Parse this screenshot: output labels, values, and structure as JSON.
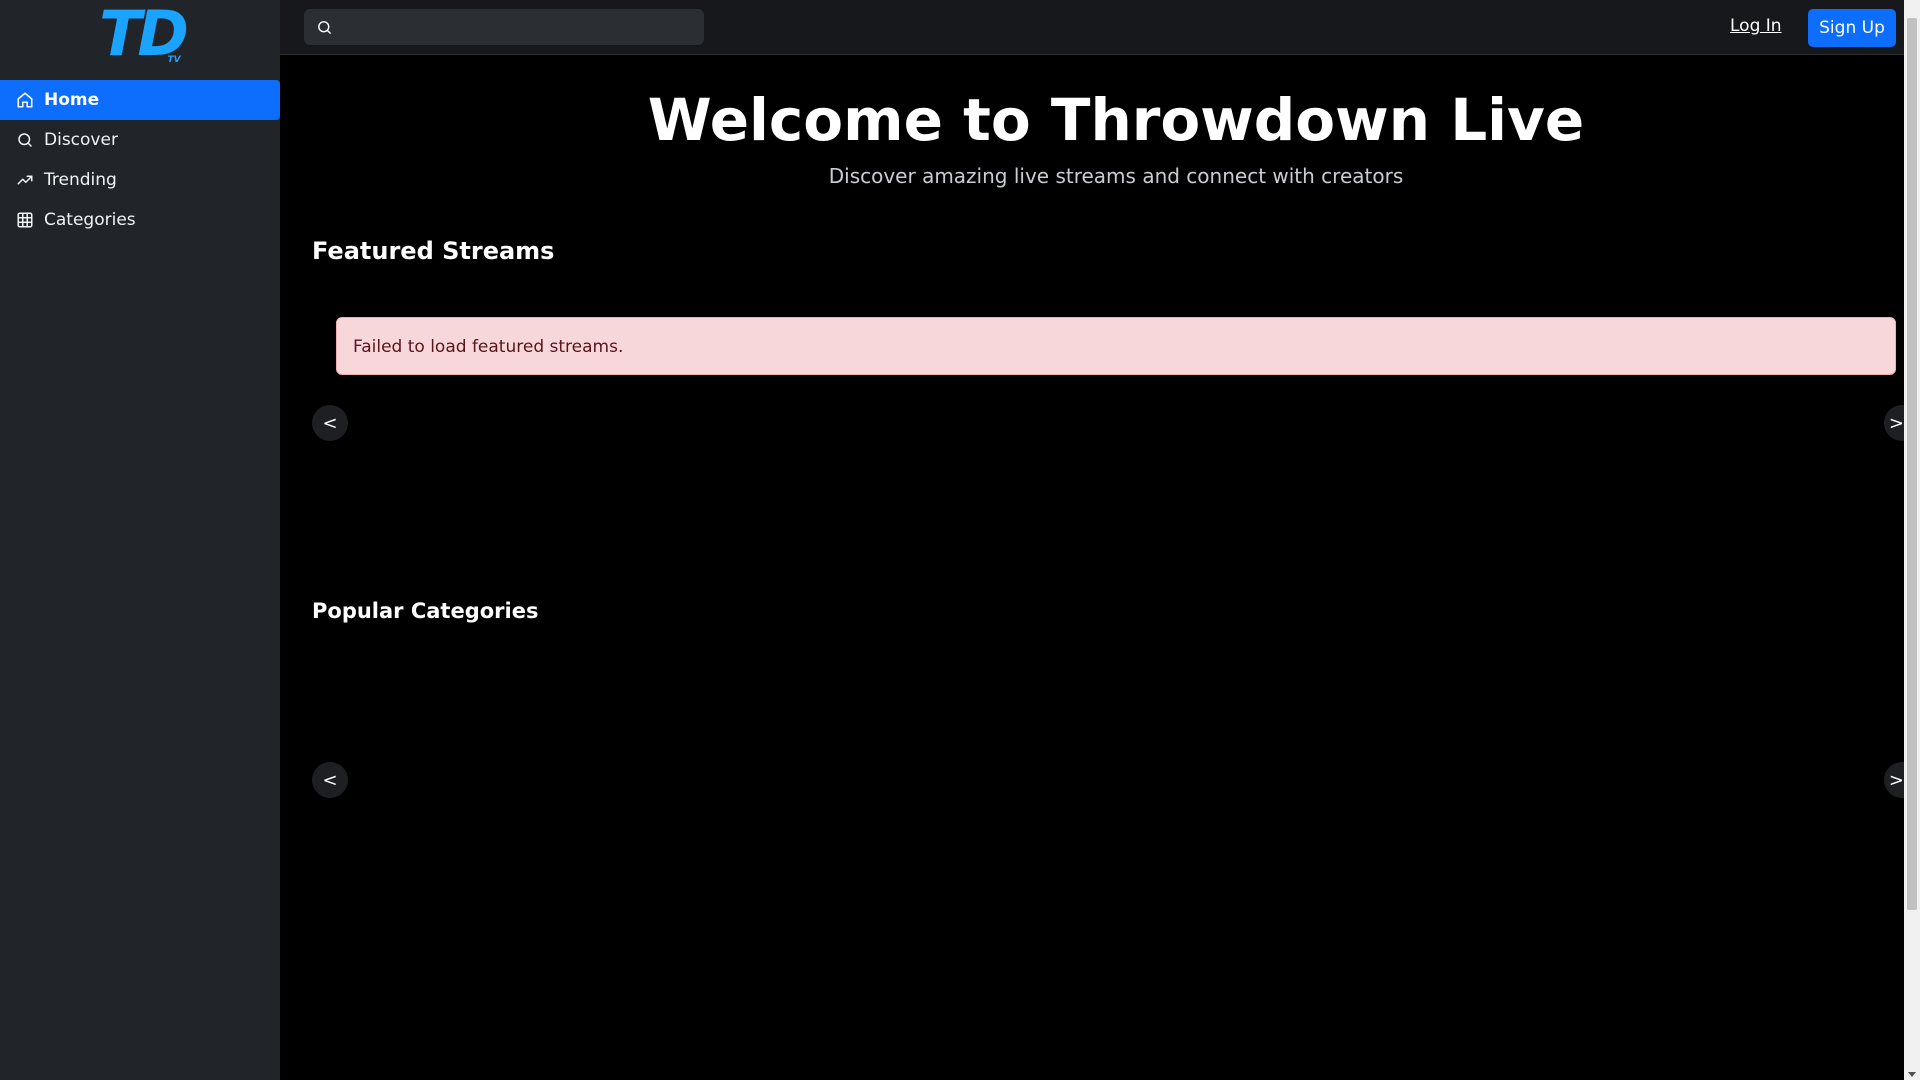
{
  "brand": {
    "logo_main": "TD",
    "logo_sub": "TV"
  },
  "sidebar": {
    "items": [
      {
        "label": "Home",
        "icon": "home-icon",
        "active": true
      },
      {
        "label": "Discover",
        "icon": "search-icon"
      },
      {
        "label": "Trending",
        "icon": "trending-icon"
      },
      {
        "label": "Categories",
        "icon": "grid-icon"
      }
    ]
  },
  "header": {
    "search_placeholder": "",
    "login_label": "Log In",
    "signup_label": "Sign Up"
  },
  "hero": {
    "title": "Welcome to Throwdown Live",
    "subtitle": "Discover amazing live streams and connect with creators"
  },
  "featured": {
    "title": "Featured Streams",
    "error": "Failed to load featured streams.",
    "prev": "<",
    "next": ">"
  },
  "categories": {
    "title": "Popular Categories",
    "prev": "<",
    "next": ">"
  },
  "colors": {
    "accent": "#0d6efd",
    "logo": "#1aa3ff",
    "sidebar_bg": "#212529",
    "alert_bg": "#f8d7da",
    "alert_text": "#58151c"
  }
}
